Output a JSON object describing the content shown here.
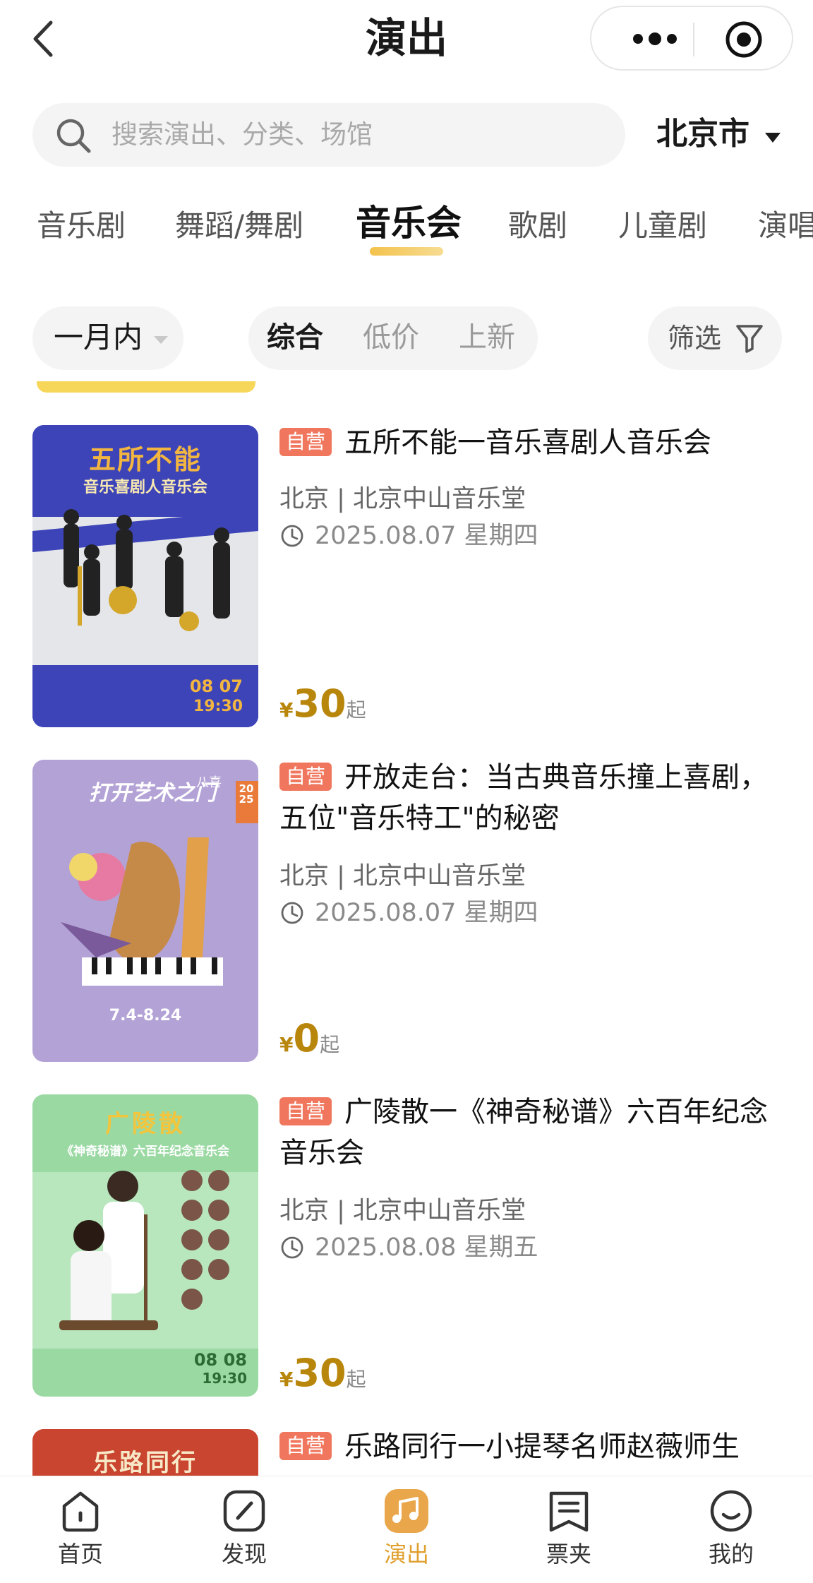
{
  "nav": {
    "title": "演出"
  },
  "search": {
    "placeholder": "搜索演出、分类、场馆"
  },
  "city": "北京市",
  "categories": [
    "音乐剧",
    "舞蹈/舞剧",
    "音乐会",
    "歌剧",
    "儿童剧",
    "演唱"
  ],
  "active_category": "音乐会",
  "filters": {
    "time": "一月内",
    "sort": [
      "综合",
      "低价",
      "上新"
    ],
    "active_sort": "综合",
    "filter_label": "筛选"
  },
  "shows": [
    {
      "tag": "自营",
      "title": "五所不能一音乐喜剧人音乐会",
      "venue": "北京 | 北京中山音乐堂",
      "date": "2025.08.07 星期四",
      "currency": "¥",
      "price": "30",
      "price_suffix": "起",
      "poster": {
        "headline": "五所不能",
        "subline": "音乐喜剧人音乐会",
        "date": "08 07",
        "time": "19:30",
        "bg": "#3d44b8"
      }
    },
    {
      "tag": "自营",
      "title": "开放走台：当古典音乐撞上喜剧，五位\"音乐特工\"的秘密",
      "venue": "北京 | 北京中山音乐堂",
      "date": "2025.08.07 星期四",
      "currency": "¥",
      "price": "0",
      "price_suffix": "起",
      "poster": {
        "headline": "打开艺术之门",
        "badge": "八喜",
        "year": "2025",
        "range": "7.4-8.24",
        "bg": "#b3a2d6"
      }
    },
    {
      "tag": "自营",
      "title": "广陵散一《神奇秘谱》六百年纪念音乐会",
      "venue": "北京 | 北京中山音乐堂",
      "date": "2025.08.08 星期五",
      "currency": "¥",
      "price": "30",
      "price_suffix": "起",
      "poster": {
        "headline": "广陵散",
        "subline": "《神奇秘谱》六百年纪念音乐会",
        "date": "08 08",
        "time": "19:30",
        "bg": "#9bd9a3"
      }
    },
    {
      "tag": "自营",
      "title": "乐路同行一小提琴名师赵薇师生",
      "poster": {
        "headline": "乐路同行",
        "bg": "#c9452f"
      }
    }
  ],
  "tabbar": [
    {
      "label": "首页",
      "icon": "home-icon"
    },
    {
      "label": "发现",
      "icon": "compass-icon"
    },
    {
      "label": "演出",
      "icon": "music-note-icon",
      "active": true
    },
    {
      "label": "票夹",
      "icon": "ticket-folder-icon"
    },
    {
      "label": "我的",
      "icon": "smile-face-icon"
    }
  ],
  "colors": {
    "accent": "#e0a02f",
    "price": "#b8860b",
    "tag": "#f0775e"
  }
}
